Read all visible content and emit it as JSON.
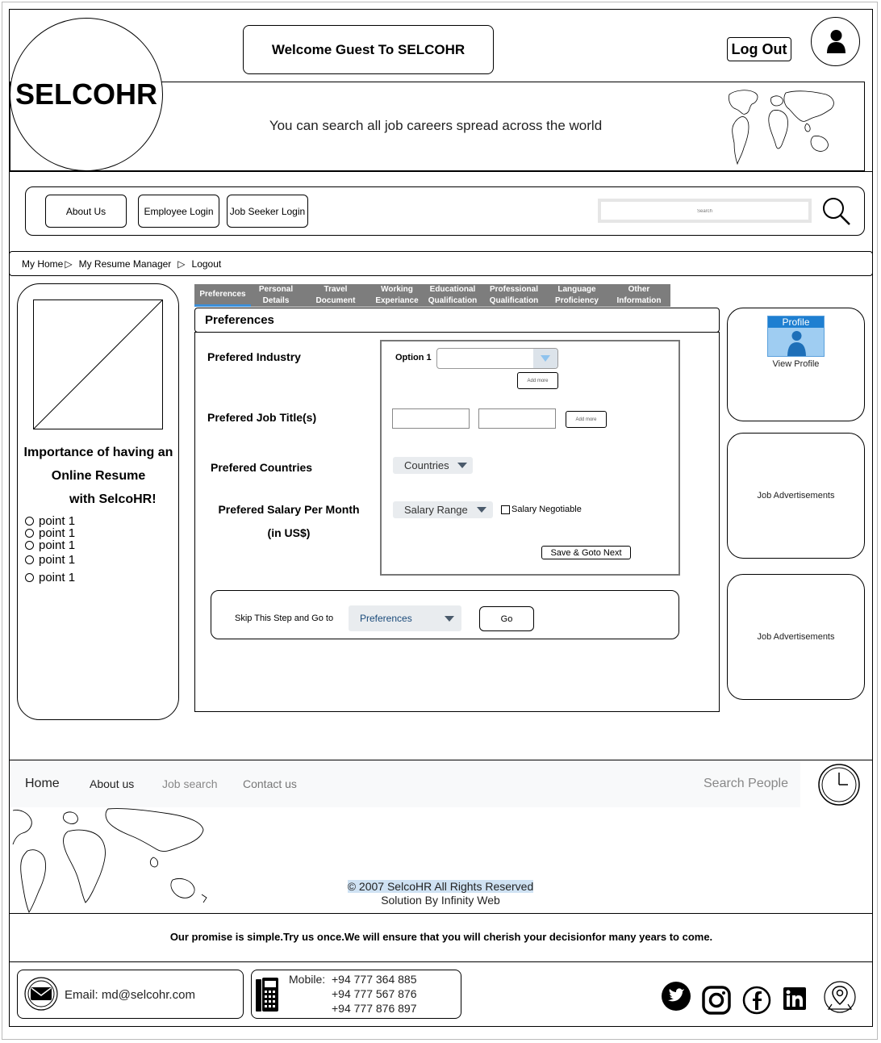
{
  "header": {
    "logo": "SELCOHR",
    "welcome": "Welcome Guest To SELCOHR",
    "logout": "Log Out",
    "tagline": "You can search all job careers spread across the world"
  },
  "nav": {
    "about": "About Us",
    "employee_login": "Employee Login",
    "jobseeker_login": "Job Seeker Login",
    "search_placeholder": "Search"
  },
  "breadcrumb": {
    "home": "My Home",
    "resume_manager": "My Resume Manager",
    "logout": "Logout"
  },
  "sidebar": {
    "title_line1": "Importance of having an",
    "title_line2": "Online Resume",
    "title_line3": "with SelcoHR!",
    "points": [
      "point 1",
      "point 1",
      "point 1",
      "point 1",
      "point 1"
    ]
  },
  "tabs": [
    {
      "line1": "Preferences",
      "line2": ""
    },
    {
      "line1": "Personal",
      "line2": "Details"
    },
    {
      "line1": "Travel",
      "line2": "Document"
    },
    {
      "line1": "Working",
      "line2": "Experiance"
    },
    {
      "line1": "Educational",
      "line2": "Qualification"
    },
    {
      "line1": "Professional",
      "line2": "Qualification"
    },
    {
      "line1": "Language",
      "line2": "Proficiency"
    },
    {
      "line1": "Other",
      "line2": "Information"
    }
  ],
  "form": {
    "section_title": "Preferences",
    "industry_label": "Prefered Industry",
    "option_label": "Option 1",
    "add_more": "Add more",
    "job_title_label": "Prefered Job Title(s)",
    "countries_label": "Prefered Countries",
    "countries_select": "Countries",
    "salary_label_line1": "Prefered Salary Per Month",
    "salary_label_line2": "(in US$)",
    "salary_select": "Salary Range",
    "salary_negotiable": "Salary Negotiable",
    "save_next": "Save & Goto Next",
    "skip_label": "Skip This Step and Go to",
    "skip_select": "Preferences",
    "go": "Go"
  },
  "right": {
    "profile_badge": "Profile",
    "view_profile": "View Profile",
    "ad1": "Job Advertisements",
    "ad2": "Job Advertisements"
  },
  "footer": {
    "home": "Home",
    "about": "About us",
    "job_search": "Job search",
    "contact": "Contact us",
    "search_people": "Search People",
    "copyright": "© 2007 SelcoHR All Rights Reserved",
    "solution": "Solution By Infinity Web",
    "promise": "Our promise is simple.Try us once.We will ensure that you will cherish your decisionfor many years to come.",
    "email": "Email: md@selcohr.com",
    "mobile_label": "Mobile:",
    "phones": [
      "+94 777 364 885",
      "+94 777 567 876",
      "+94 777 876 897"
    ]
  },
  "icons": {
    "user": "user-icon",
    "search": "search-icon",
    "world_map": "world-map-icon",
    "clock": "clock-icon",
    "mail": "mail-icon",
    "phone": "phone-icon",
    "twitter": "twitter-icon",
    "instagram": "instagram-icon",
    "facebook": "facebook-icon",
    "linkedin": "linkedin-icon",
    "location": "location-icon"
  },
  "colors": {
    "tab_bg": "#7d7d7d",
    "tab_active_underline": "#3b8fd9",
    "profile_blue": "#1e7fd1",
    "footer_bg": "#f8f9fa"
  }
}
